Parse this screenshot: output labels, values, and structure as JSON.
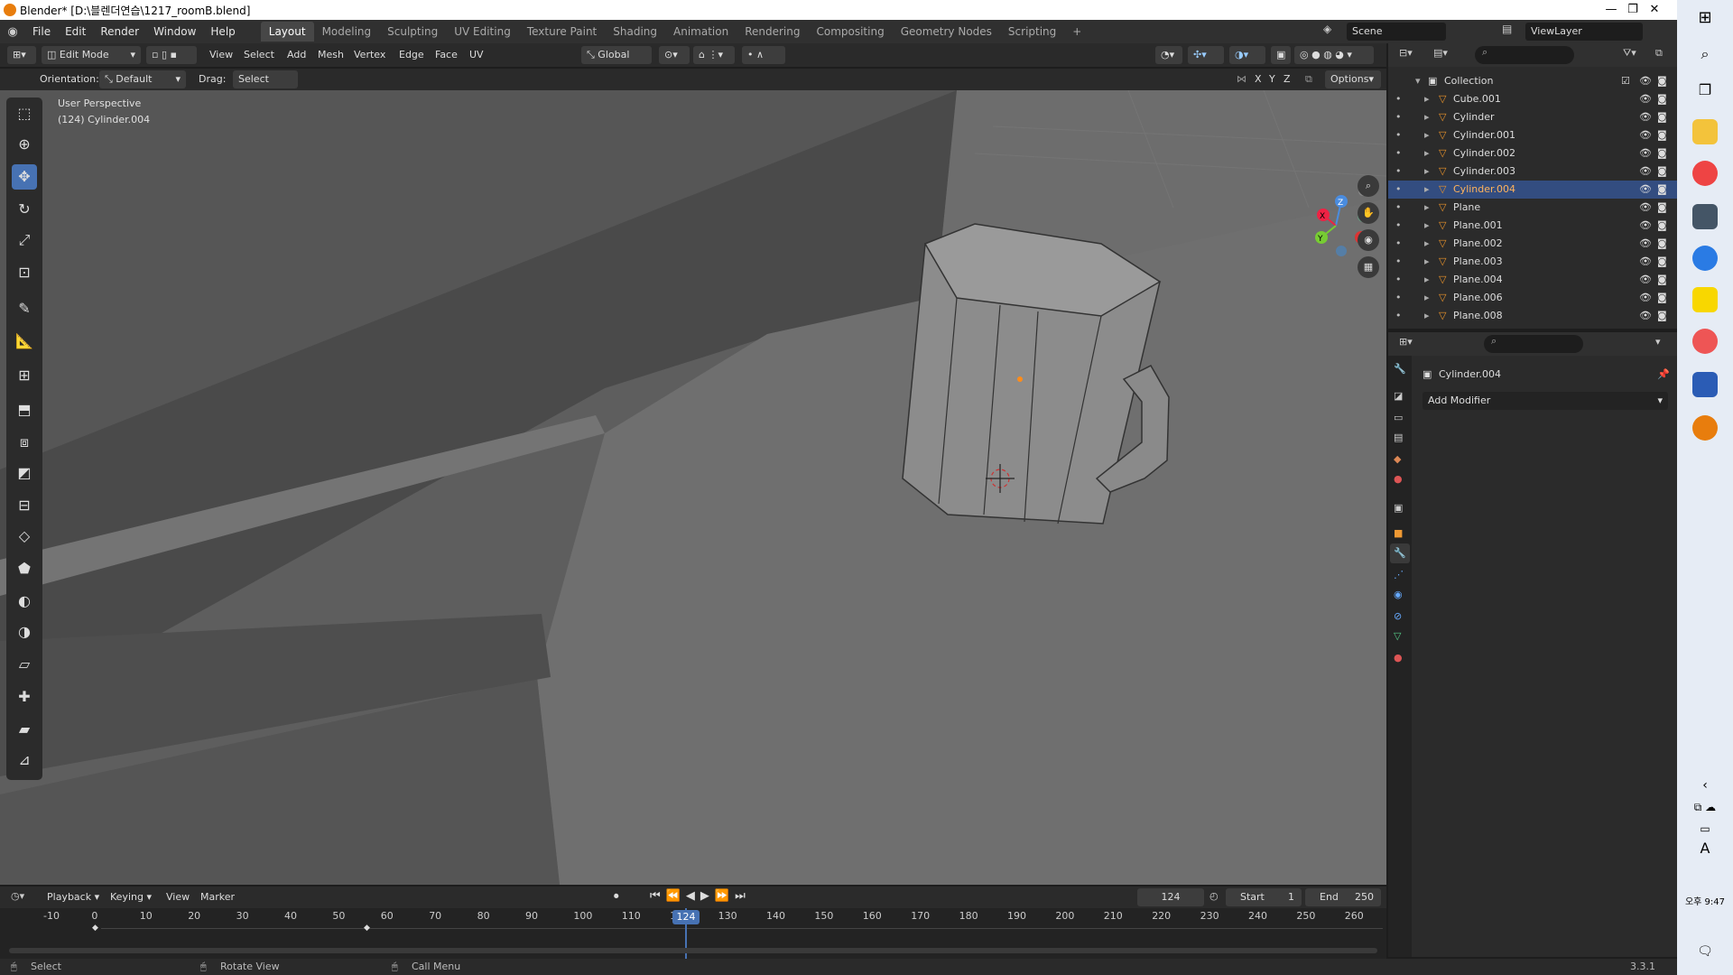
{
  "window": {
    "title": "Blender* [D:\\블렌더연습\\1217_roomB.blend]",
    "controls": [
      "—",
      "❐",
      "✕"
    ]
  },
  "menus": [
    "File",
    "Edit",
    "Render",
    "Window",
    "Help"
  ],
  "workspaces": [
    "Layout",
    "Modeling",
    "Sculpting",
    "UV Editing",
    "Texture Paint",
    "Shading",
    "Animation",
    "Rendering",
    "Compositing",
    "Geometry Nodes",
    "Scripting",
    "+"
  ],
  "scene": {
    "name": "Scene",
    "view_layer": "ViewLayer"
  },
  "header": {
    "mode": "Edit Mode",
    "menus": [
      "View",
      "Select",
      "Add",
      "Mesh",
      "Vertex",
      "Edge",
      "Face",
      "UV"
    ],
    "transform": "Global",
    "orientation_label": "Orientation:",
    "orientation_value": "Default",
    "drag_label": "Drag:",
    "drag_value": "Select Box",
    "options": "Options",
    "axes": [
      "X",
      "Y",
      "Z"
    ]
  },
  "viewport": {
    "perspective": "User Perspective",
    "object": "(124) Cylinder.004",
    "gizmo": [
      "X",
      "Y",
      "Z"
    ]
  },
  "outliner": {
    "collection": "Collection",
    "items": [
      {
        "name": "Cube.001",
        "selected": false
      },
      {
        "name": "Cylinder",
        "selected": false
      },
      {
        "name": "Cylinder.001",
        "selected": false
      },
      {
        "name": "Cylinder.002",
        "selected": false
      },
      {
        "name": "Cylinder.003",
        "selected": false
      },
      {
        "name": "Cylinder.004",
        "selected": true
      },
      {
        "name": "Plane",
        "selected": false
      },
      {
        "name": "Plane.001",
        "selected": false
      },
      {
        "name": "Plane.002",
        "selected": false
      },
      {
        "name": "Plane.003",
        "selected": false
      },
      {
        "name": "Plane.004",
        "selected": false
      },
      {
        "name": "Plane.006",
        "selected": false
      },
      {
        "name": "Plane.008",
        "selected": false
      }
    ]
  },
  "properties": {
    "object": "Cylinder.004",
    "add_modifier": "Add Modifier"
  },
  "timeline": {
    "menus": [
      "Playback",
      "Keying",
      "View",
      "Marker"
    ],
    "current_frame": "124",
    "start_label": "Start",
    "start": "1",
    "end_label": "End",
    "end": "250",
    "ticks": [
      "-10",
      "0",
      "10",
      "20",
      "30",
      "40",
      "50",
      "60",
      "70",
      "80",
      "90",
      "100",
      "110",
      "120",
      "130",
      "140",
      "150",
      "160",
      "170",
      "180",
      "190",
      "200",
      "210",
      "220",
      "230",
      "240",
      "250",
      "260"
    ]
  },
  "status": {
    "select": "Select",
    "rotate": "Rotate View",
    "call_menu": "Call Menu",
    "version": "3.3.1"
  },
  "taskbar": {
    "time": "오후 9:47",
    "ime": "A"
  }
}
